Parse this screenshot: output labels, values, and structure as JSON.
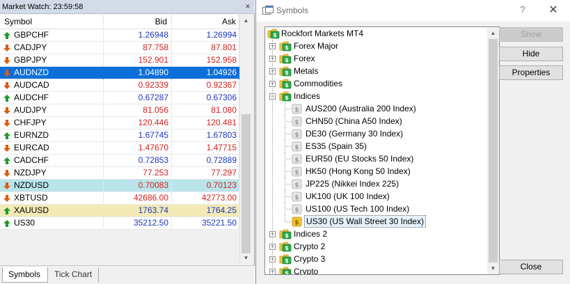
{
  "market_watch": {
    "title": "Market Watch: 23:59:58",
    "close_glyph": "×",
    "columns": {
      "symbol": "Symbol",
      "bid": "Bid",
      "ask": "Ask"
    },
    "rows": [
      {
        "symbol": "GBPCHF",
        "bid": "1.26948",
        "ask": "1.26994",
        "dir": "up",
        "state": ""
      },
      {
        "symbol": "CADJPY",
        "bid": "87.758",
        "ask": "87.801",
        "dir": "down",
        "state": ""
      },
      {
        "symbol": "GBPJPY",
        "bid": "152.901",
        "ask": "152.958",
        "dir": "down",
        "state": ""
      },
      {
        "symbol": "AUDNZD",
        "bid": "1.04890",
        "ask": "1.04926",
        "dir": "down",
        "state": "selected"
      },
      {
        "symbol": "AUDCAD",
        "bid": "0.92339",
        "ask": "0.92367",
        "dir": "down",
        "state": ""
      },
      {
        "symbol": "AUDCHF",
        "bid": "0.67287",
        "ask": "0.67306",
        "dir": "up",
        "state": ""
      },
      {
        "symbol": "AUDJPY",
        "bid": "81.056",
        "ask": "81.080",
        "dir": "down",
        "state": ""
      },
      {
        "symbol": "CHFJPY",
        "bid": "120.446",
        "ask": "120.481",
        "dir": "down",
        "state": ""
      },
      {
        "symbol": "EURNZD",
        "bid": "1.67745",
        "ask": "1.67803",
        "dir": "up",
        "state": ""
      },
      {
        "symbol": "EURCAD",
        "bid": "1.47670",
        "ask": "1.47715",
        "dir": "down",
        "state": ""
      },
      {
        "symbol": "CADCHF",
        "bid": "0.72853",
        "ask": "0.72889",
        "dir": "up",
        "state": ""
      },
      {
        "symbol": "NZDJPY",
        "bid": "77.253",
        "ask": "77.297",
        "dir": "down",
        "state": ""
      },
      {
        "symbol": "NZDUSD",
        "bid": "0.70083",
        "ask": "0.70123",
        "dir": "down",
        "state": "cyan"
      },
      {
        "symbol": "XBTUSD",
        "bid": "42686.00",
        "ask": "42773.00",
        "dir": "down",
        "state": ""
      },
      {
        "symbol": "XAUUSD",
        "bid": "1763.74",
        "ask": "1764.25",
        "dir": "up",
        "state": "yellow"
      },
      {
        "symbol": "US30",
        "bid": "35212.50",
        "ask": "35221.50",
        "dir": "up",
        "state": ""
      }
    ],
    "tabs": [
      {
        "label": "Symbols",
        "active": true
      },
      {
        "label": "Tick Chart",
        "active": false
      }
    ],
    "colors": {
      "up": "#1a35c4",
      "down": "#d62020",
      "up_arrow": "#1f9a2b",
      "down_arrow": "#e05a10",
      "selected": "#0a6fd8"
    }
  },
  "symbols_dialog": {
    "title": "Symbols",
    "help_glyph": "?",
    "close_glyph": "✕",
    "root": "Rockfort Markets MT4",
    "groups_before": [
      "Forex Major",
      "Forex",
      "Metals",
      "Commodities"
    ],
    "expanded_group": "Indices",
    "expanded_items": [
      "AUS200  (Australia 200 Index)",
      "CHN50  (China A50 Index)",
      "DE30  (Germany 30 Index)",
      "ES35  (Spain 35)",
      "EUR50  (EU Stocks 50 Index)",
      "HK50  (Hong Kong 50 Index)",
      "JP225  (Nikkei Index 225)",
      "UK100  (UK 100 Index)",
      "US100  (US Tech 100 Index)",
      "US30  (US Wall Street 30 Index)"
    ],
    "selected_item": "US30  (US Wall Street 30 Index)",
    "groups_after": [
      "Indices 2",
      "Crypto 2",
      "Crypto 3",
      "Crypto"
    ],
    "buttons": {
      "show": "Show",
      "hide": "Hide",
      "properties": "Properties",
      "close": "Close"
    }
  }
}
